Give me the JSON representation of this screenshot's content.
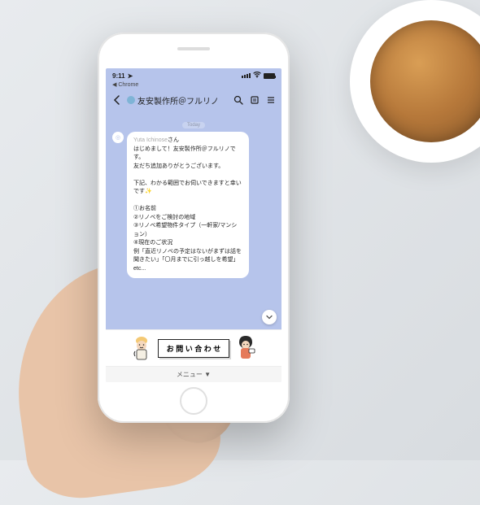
{
  "statusbar": {
    "time": "9:11",
    "source": "Chrome"
  },
  "navbar": {
    "title": "友安製作所＠フルリノ"
  },
  "chat": {
    "today": "Today",
    "sender_avatar_alt": "bot-avatar",
    "message": {
      "username": "Yuta Ichinose",
      "greeting_suffix": "さん",
      "line1": "はじめまして！友安製作所＠フルリノです。",
      "line2": "友だち追加ありがとうございます。",
      "line3": "下記、わかる範囲でお伺いできますと幸いです",
      "q1": "①お名前",
      "q2": "②リノベをご検討の地域",
      "q3": "③リノベ希望物件タイプ（一軒家/マンション）",
      "q4": "④現在のご状況",
      "example": "例「直近リノベの予定はないがまずは話を聞きたい」「〇月までに引っ越しを希望」etc..."
    }
  },
  "richmenu": {
    "contact_label": "お 問 い 合 わ せ",
    "menu_label": "メニュー ▼"
  }
}
